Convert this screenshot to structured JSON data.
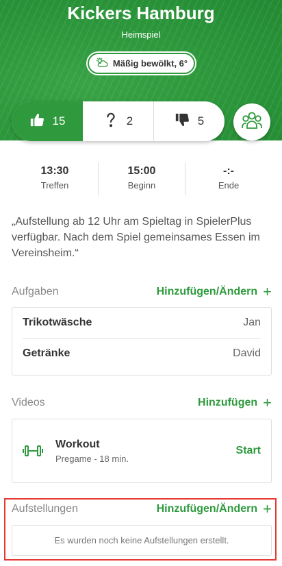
{
  "header": {
    "title": "Kickers Hamburg",
    "subtitle": "Heimspiel",
    "weather": {
      "icon": "cloud-sun-icon",
      "label": "Mäßig bewölkt, 6°"
    }
  },
  "votes": {
    "yes": {
      "icon": "thumbs-up-icon",
      "count": "15"
    },
    "maybe": {
      "icon": "question-icon",
      "count": "2"
    },
    "no": {
      "icon": "thumbs-down-icon",
      "count": "5"
    },
    "members_icon": "group-icon"
  },
  "times": [
    {
      "value": "13:30",
      "label": "Treffen"
    },
    {
      "value": "15:00",
      "label": "Beginn"
    },
    {
      "value": "-:-",
      "label": "Ende"
    }
  ],
  "note": "„Aufstellung ab 12 Uhr am Spieltag in SpielerPlus verfügbar. Nach dem Spiel gemeinsames Essen im Vereinsheim.“",
  "tasks": {
    "title": "Aufgaben",
    "action": "Hinzufügen/Ändern",
    "items": [
      {
        "name": "Trikotwäsche",
        "who": "Jan"
      },
      {
        "name": "Getränke",
        "who": "David"
      }
    ]
  },
  "videos": {
    "title": "Videos",
    "action": "Hinzufügen",
    "items": [
      {
        "icon": "dumbbell-icon",
        "title": "Workout",
        "subtitle": "Pregame - 18 min.",
        "action": "Start"
      }
    ]
  },
  "lineups": {
    "title": "Aufstellungen",
    "action": "Hinzufügen/Ändern",
    "empty_text": "Es wurden noch keine Aufstellungen erstellt."
  },
  "colors": {
    "accent": "#2e9a3d",
    "highlight": "#e53935"
  }
}
